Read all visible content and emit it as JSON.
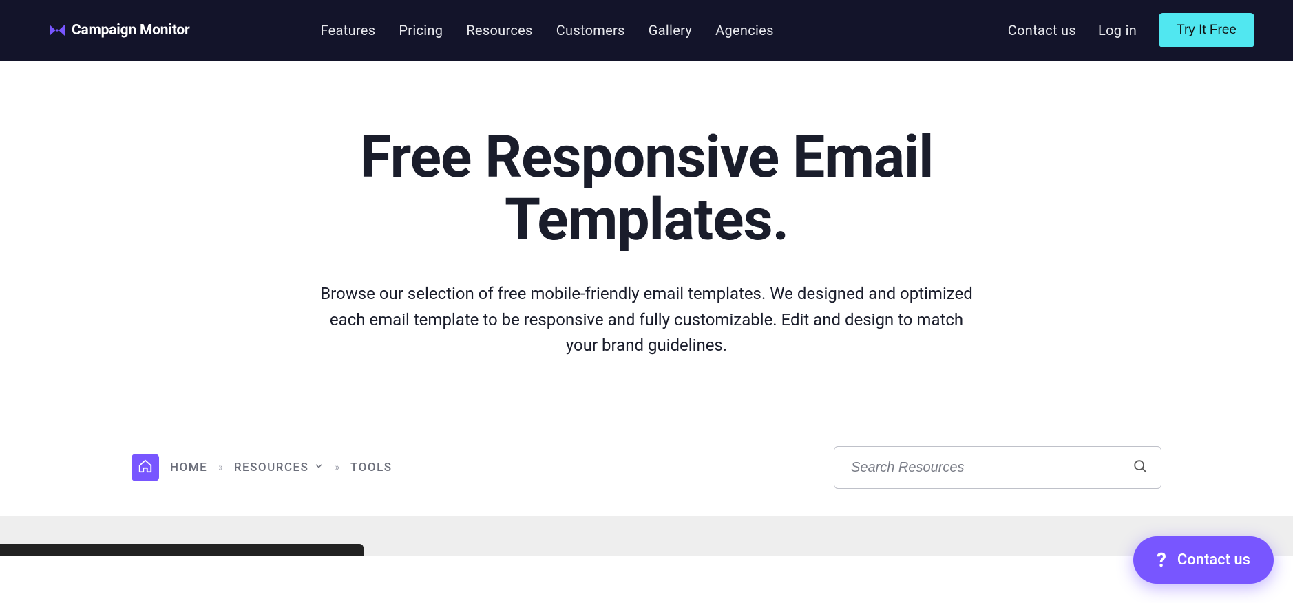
{
  "brand": {
    "name": "Campaign Monitor"
  },
  "nav": {
    "center": [
      {
        "label": "Features"
      },
      {
        "label": "Pricing"
      },
      {
        "label": "Resources"
      },
      {
        "label": "Customers"
      },
      {
        "label": "Gallery"
      },
      {
        "label": "Agencies"
      }
    ],
    "right": {
      "contact": "Contact us",
      "login": "Log in",
      "cta": "Try It Free"
    }
  },
  "hero": {
    "title": "Free Responsive Email Templates.",
    "description": "Browse our selection of free mobile-friendly email templates. We designed and optimized each email template to be responsive and fully customizable. Edit and design to match your brand guidelines."
  },
  "breadcrumb": {
    "home": "HOME",
    "resources": "RESOURCES",
    "tools": "TOOLS",
    "separator": "»"
  },
  "search": {
    "placeholder": "Search Resources"
  },
  "widget": {
    "label": "Contact us"
  },
  "colors": {
    "headerBg": "#13142a",
    "accent": "#7856ff",
    "cta": "#51e7f0"
  }
}
